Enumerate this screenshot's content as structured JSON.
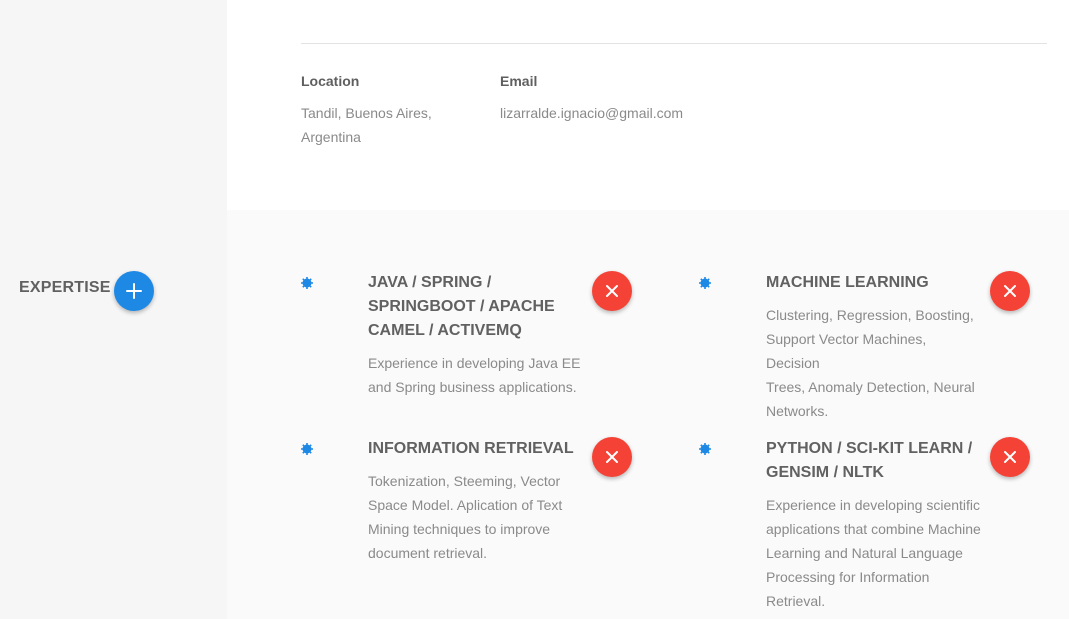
{
  "contact": {
    "location_label": "Location",
    "location_line1": "Tandil, Buenos Aires,",
    "location_line2": "Argentina",
    "email_label": "Email",
    "email_value": "lizarralde.ignacio@gmail.com"
  },
  "expertise": {
    "section_title": "EXPERTISE",
    "add_icon": "plus-icon",
    "remove_icon": "close-icon",
    "bullet_icon": "gear-bullet-icon",
    "colors": {
      "accent_blue": "#1e88e5",
      "remove_red": "#f44336"
    },
    "items": [
      {
        "title_lines": [
          "JAVA / SPRING /",
          "SPRINGBOOT / APACHE",
          "CAMEL / ACTIVEMQ"
        ],
        "desc_lines": [
          "Experience in developing Java EE",
          "and Spring business applications."
        ]
      },
      {
        "title_lines": [
          "MACHINE LEARNING"
        ],
        "desc_lines": [
          "Clustering, Regression, Boosting,",
          "Support Vector Machines, Decision",
          "Trees, Anomaly Detection, Neural",
          "Networks."
        ]
      },
      {
        "title_lines": [
          "INFORMATION RETRIEVAL"
        ],
        "desc_lines": [
          "Tokenization, Steeming, Vector",
          "Space Model. Aplication of Text",
          "Mining techniques to improve",
          "document retrieval."
        ]
      },
      {
        "title_lines": [
          "PYTHON / SCI-KIT LEARN /",
          "GENSIM / NLTK"
        ],
        "desc_lines": [
          "Experience in developing scientific",
          "applications that combine Machine",
          "Learning and Natural Language",
          "Processing for Information",
          "Retrieval."
        ]
      }
    ]
  }
}
